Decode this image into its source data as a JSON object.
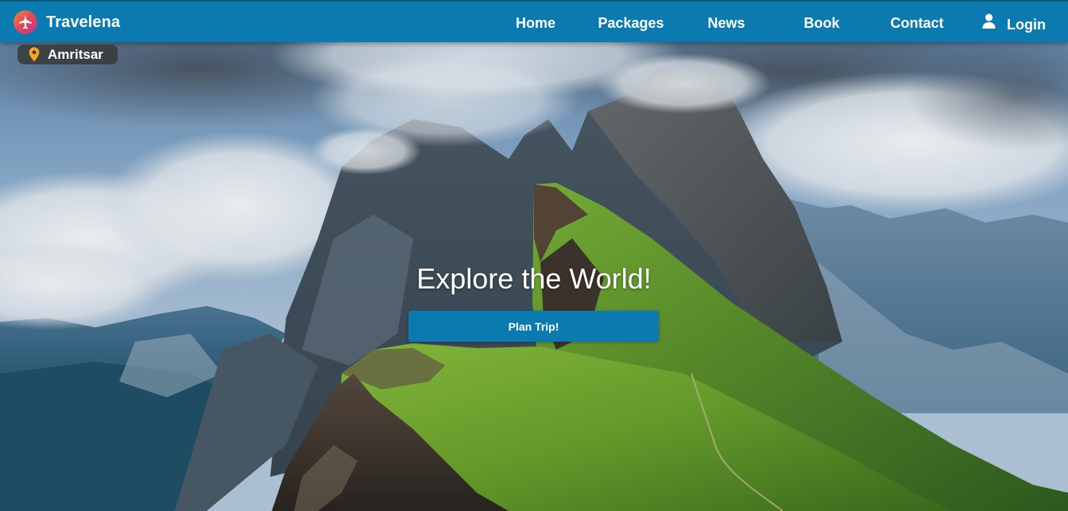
{
  "navbar": {
    "brand_name": "Travelena",
    "links": {
      "home": "Home",
      "packages": "Packages",
      "news": "News",
      "book": "Book",
      "contact": "Contact",
      "login": "Login"
    },
    "background_color": "#0a7ab0"
  },
  "location": {
    "city": "Amritsar",
    "pin_color": "#f5a623"
  },
  "hero": {
    "title": "Explore the World!",
    "button_label": "Plan Trip!",
    "button_color": "#0a7ab0"
  },
  "icons": {
    "brand": "airplane-logo-icon",
    "login": "user-icon",
    "location": "map-pin-icon"
  }
}
